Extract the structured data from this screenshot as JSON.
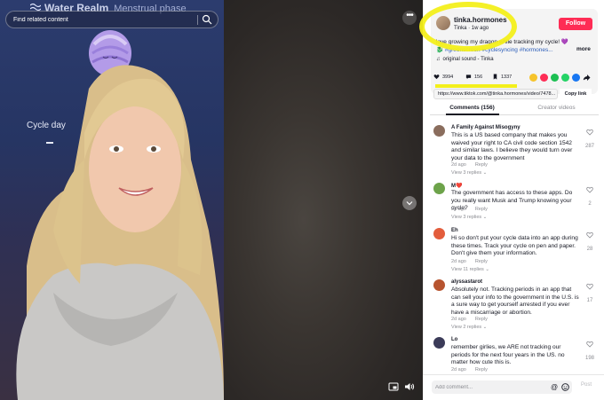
{
  "video": {
    "overlay_title": "Water Realm",
    "overlay_subtitle": "Menstrual phase",
    "cycle_label": "Cycle day",
    "search_placeholder": "Find related content",
    "more_label": "•••"
  },
  "creator": {
    "username": "tinka.hormones",
    "display_name": "Tinka",
    "time_ago": "1w ago",
    "follow_label": "Follow",
    "description_text": "love growing my dragon while tracking my cycle! 💜 🐉",
    "description_tags": "#greenscreen #cyclesyncing #hormones...",
    "more_label": "more",
    "sound": "original sound - Tinka"
  },
  "actions": {
    "likes": "3994",
    "comments": "156",
    "saves": "1337",
    "share_colors": [
      "#f6c42c",
      "#fe2c55",
      "#1cbf52",
      "#25d366",
      "#1877f2",
      "#161823"
    ]
  },
  "link": {
    "url": "https://www.tiktok.com/@tinka.hormones/video/7478...",
    "copy_label": "Copy link"
  },
  "tabs": {
    "comments": "Comments (156)",
    "creator_videos": "Creator videos"
  },
  "comments": [
    {
      "name": "A Family Against Misogyny",
      "text": "This is a US based company that makes you waived your right to CA civil code section 1542 and similar laws. I believe they would turn over your data to the government",
      "date": "2d ago",
      "reply": "Reply",
      "replies": "View 3 replies",
      "likes": "287",
      "avatar_color": "#8a6d5d"
    },
    {
      "name": "M❤️",
      "text": "The government has access to these apps. Do you really want Musk and Trump knowing your cycle?",
      "date": "2d ago",
      "reply": "Reply",
      "replies": "View 3 replies",
      "likes": "2",
      "avatar_color": "#6da34a"
    },
    {
      "name": "Eh",
      "text": "Hi so don't put your cycle data into an app during these times. Track your cycle on pen and paper. Don't give them your information.",
      "date": "2d ago",
      "reply": "Reply",
      "replies": "View 11 replies",
      "likes": "28",
      "avatar_color": "#e35d3c"
    },
    {
      "name": "alyssastarot",
      "text": "Absolutely not. Tracking periods in an app that can sell your info to the government in the U.S. is a sure way to get yourself arrested if you ever have a miscarriage or abortion.",
      "date": "2d ago",
      "reply": "Reply",
      "replies": "View 2 replies",
      "likes": "17",
      "avatar_color": "#b7542f"
    },
    {
      "name": "Lo",
      "text": "remember girlies, we ARE not tracking our periods for the next four years in the US. no matter how cute this is.",
      "date": "2d ago",
      "reply": "Reply",
      "replies": "",
      "likes": "198",
      "avatar_color": "#3b3b58"
    }
  ],
  "add_comment": {
    "placeholder": "Add comment...",
    "at_symbol": "@",
    "post_label": "Post"
  }
}
